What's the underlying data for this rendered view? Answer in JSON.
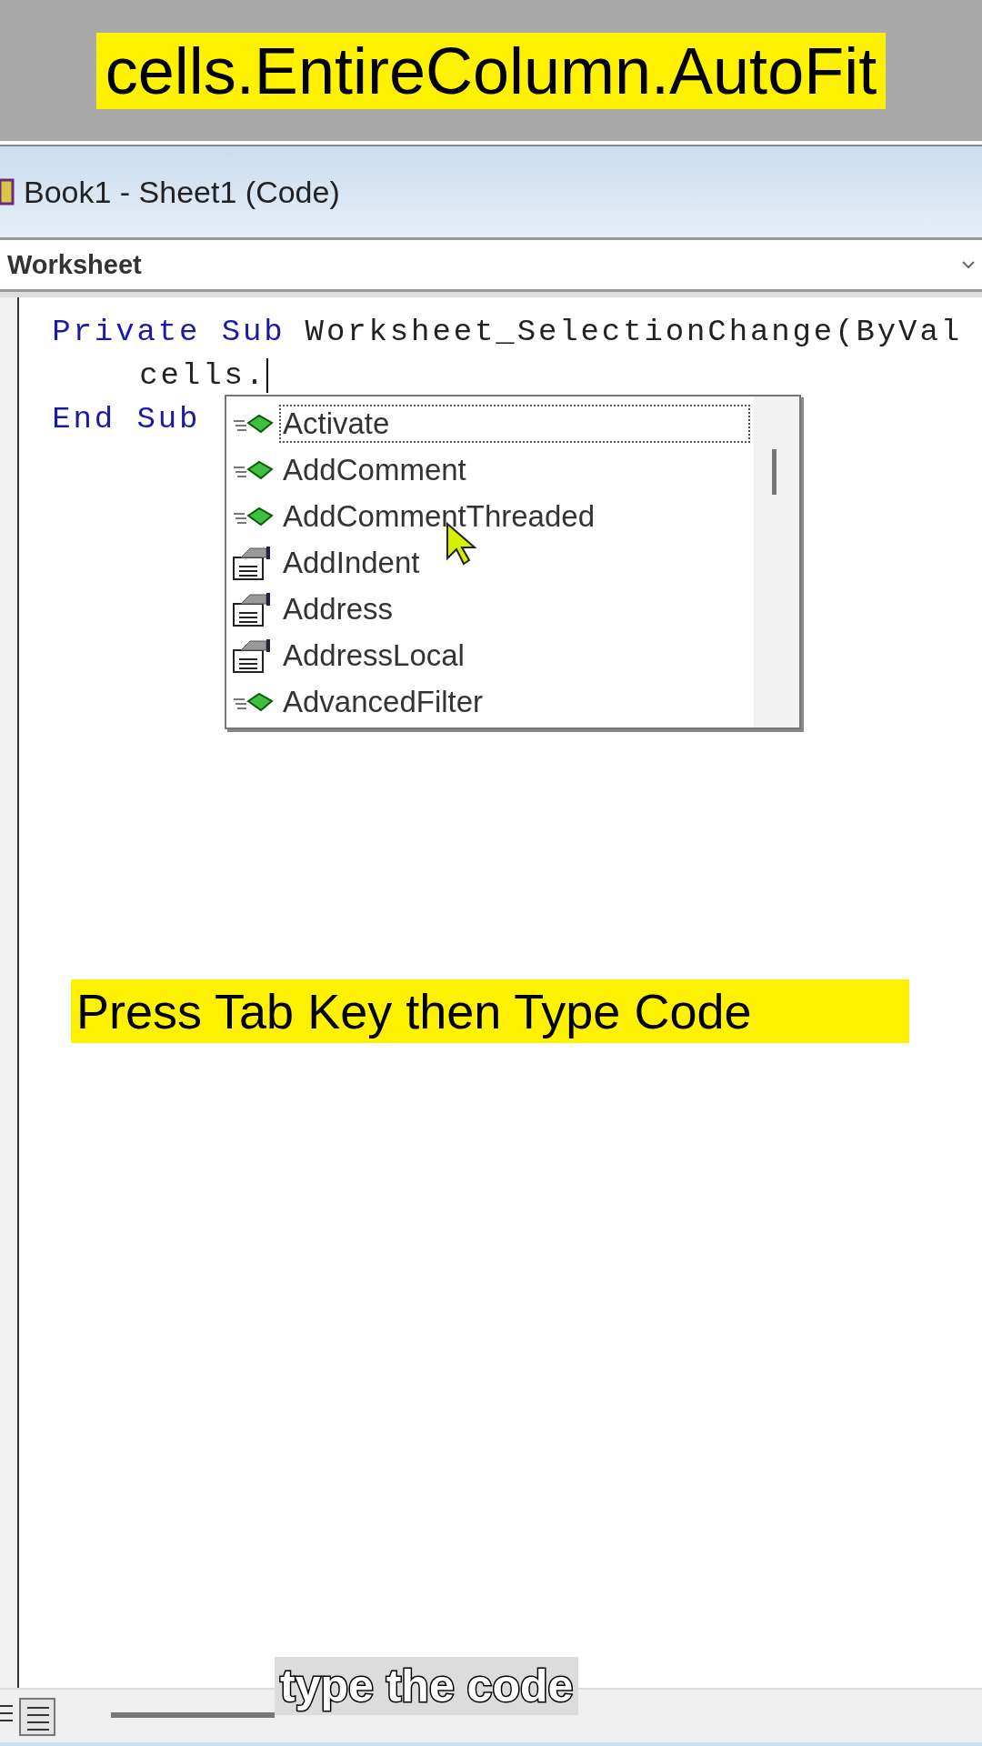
{
  "caption": "cells.EntireColumn.AutoFit",
  "window": {
    "title": "Book1 - Sheet1 (Code)"
  },
  "object_dropdown": {
    "value": "Worksheet"
  },
  "code_lines": [
    {
      "indent": false,
      "parts": [
        {
          "kind": "keyword",
          "text": "Private Sub"
        },
        {
          "kind": "plain",
          "text": "Worksheet_SelectionChange(ByVal"
        }
      ]
    },
    {
      "indent": true,
      "parts": [
        {
          "kind": "plain",
          "text": "cells."
        }
      ],
      "caret": true
    },
    {
      "indent": false,
      "parts": [
        {
          "kind": "keyword",
          "text": "End Sub"
        }
      ]
    }
  ],
  "autocomplete": {
    "items": [
      {
        "label": "Activate",
        "kind": "method",
        "selected": true
      },
      {
        "label": "AddComment",
        "kind": "method",
        "selected": false
      },
      {
        "label": "AddCommentThreaded",
        "kind": "method",
        "selected": false
      },
      {
        "label": "AddIndent",
        "kind": "property",
        "selected": false
      },
      {
        "label": "Address",
        "kind": "property",
        "selected": false
      },
      {
        "label": "AddressLocal",
        "kind": "property",
        "selected": false
      },
      {
        "label": "AdvancedFilter",
        "kind": "method",
        "selected": false
      }
    ]
  },
  "overlay_text": "Press Tab Key then Type Code",
  "subtitle": "type the code"
}
